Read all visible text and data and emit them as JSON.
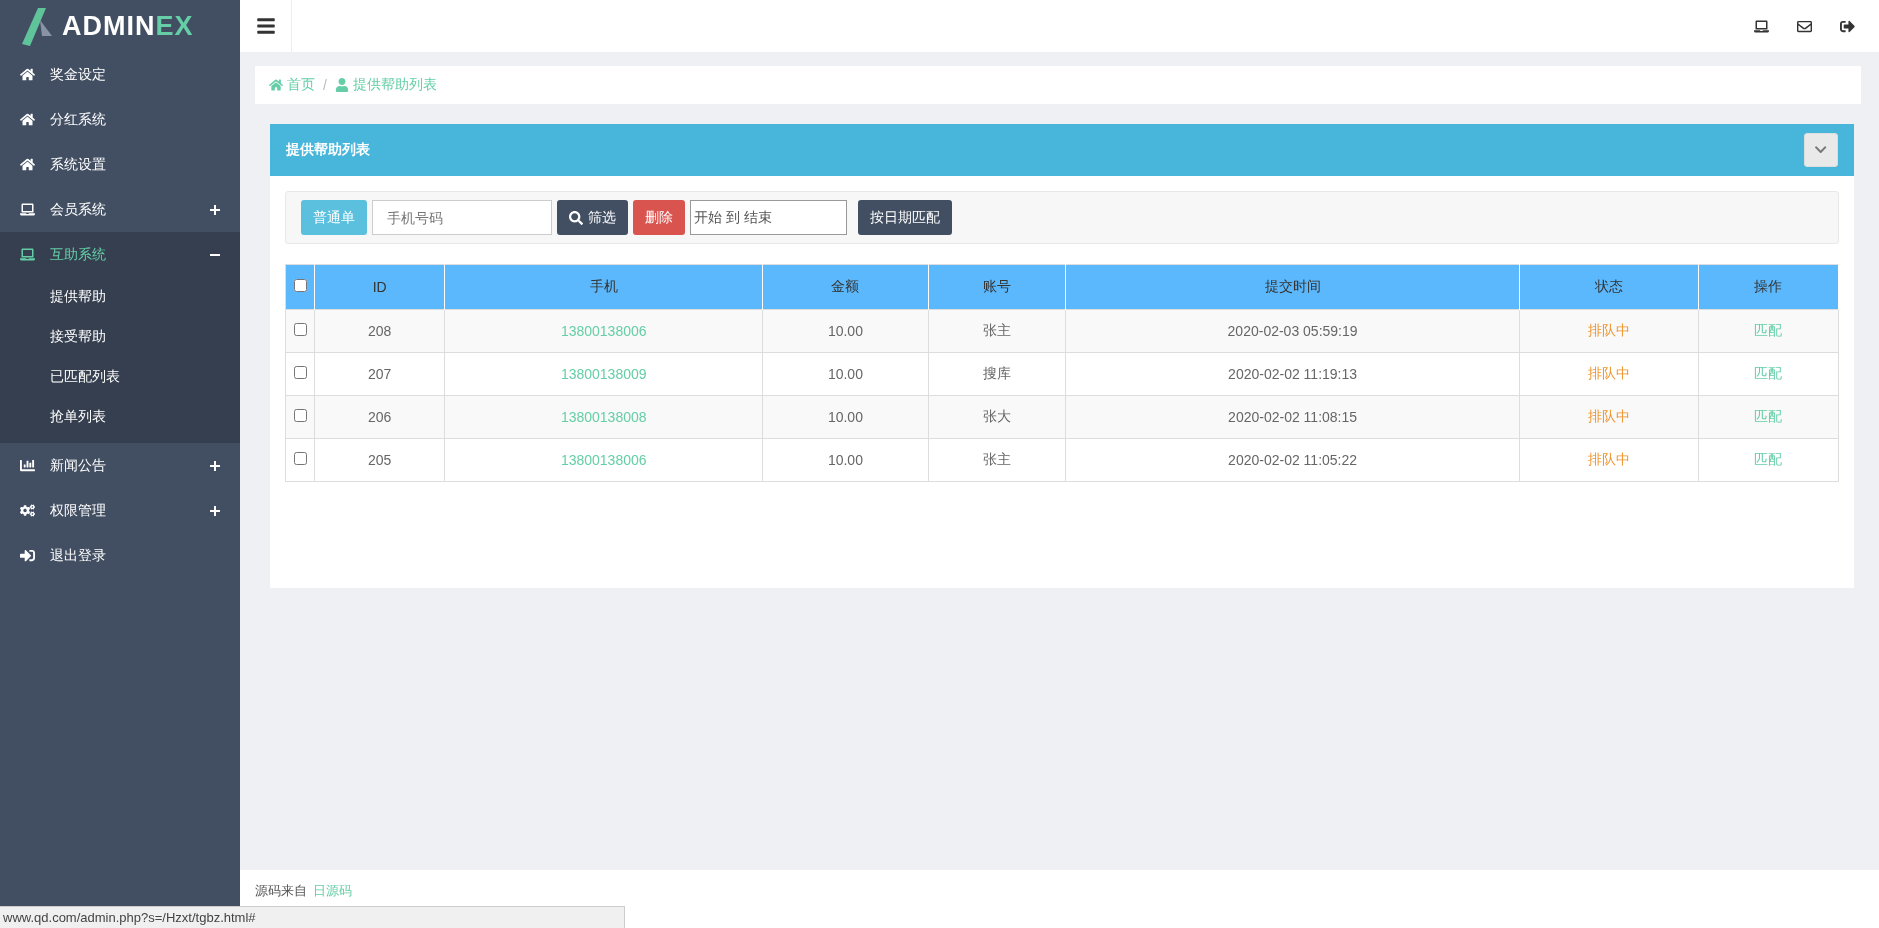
{
  "logo": {
    "part_1": "ADMIN",
    "part_2": "EX"
  },
  "sidebar": {
    "items": [
      {
        "label": "奖金设定",
        "selected": false
      },
      {
        "label": "分红系统",
        "selected": false
      },
      {
        "label": "系统设置",
        "selected": false
      },
      {
        "label": "会员系统",
        "selected": false,
        "expanded": false
      },
      {
        "label": "互助系统",
        "selected": true,
        "expanded": true,
        "children": [
          {
            "label": "提供帮助"
          },
          {
            "label": "接受帮助"
          },
          {
            "label": "已匹配列表"
          },
          {
            "label": "抢单列表"
          }
        ]
      },
      {
        "label": "新闻公告",
        "selected": false,
        "expanded": false
      },
      {
        "label": "权限管理",
        "selected": false,
        "expanded": false
      },
      {
        "label": "退出登录",
        "selected": false
      }
    ]
  },
  "breadcrumb": [
    "首页",
    "提供帮助列表"
  ],
  "breadcrumb_separator": "/",
  "panel": {
    "title": "提供帮助列表",
    "toolbar": {
      "type_button": "普通单",
      "phone_placeholder": "手机号码",
      "filter_button": "筛选",
      "delete_button": "删除",
      "date_range": "开始 到 结束",
      "match_button": "按日期匹配"
    },
    "table": {
      "select_all": false,
      "columns": [
        "ID",
        "手机",
        "金额",
        "账号",
        "提交时间",
        "状态",
        "操作"
      ],
      "rows": [
        {
          "checked": false,
          "cells": [
            "208",
            "13800138006",
            "10.00",
            "张主",
            "2020-02-03 05:59:19",
            "排队中",
            "匹配"
          ]
        },
        {
          "checked": false,
          "cells": [
            "207",
            "13800138009",
            "10.00",
            "搜库",
            "2020-02-02 11:19:13",
            "排队中",
            "匹配"
          ]
        },
        {
          "checked": false,
          "cells": [
            "206",
            "13800138008",
            "10.00",
            "张大",
            "2020-02-02 11:08:15",
            "排队中",
            "匹配"
          ]
        },
        {
          "checked": false,
          "cells": [
            "205",
            "13800138006",
            "10.00",
            "张主",
            "2020-02-02 11:05:22",
            "排队中",
            "匹配"
          ]
        }
      ]
    }
  },
  "footer": {
    "text": "源码来自",
    "link": "日源码"
  },
  "status_url": "www.qd.com/admin.php?s=/Hzxt/tgbz.html#"
}
